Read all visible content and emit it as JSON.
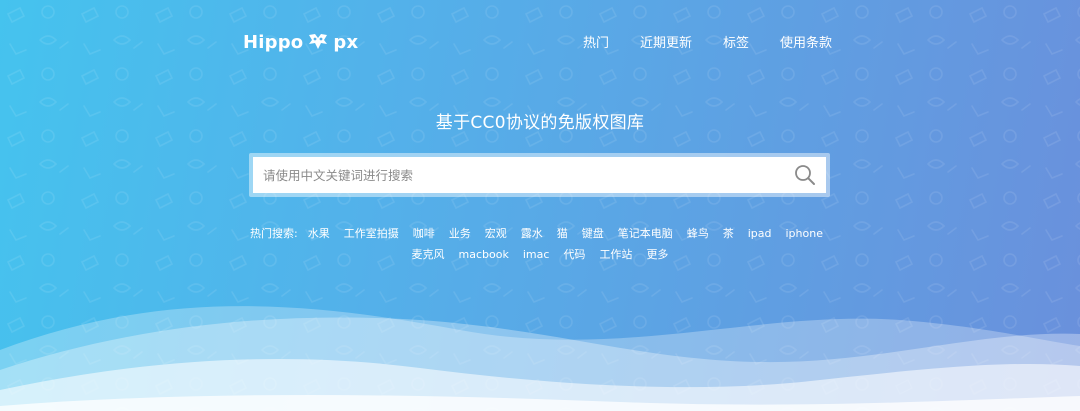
{
  "header": {
    "logo_left": "Hippo",
    "logo_right": "px",
    "nav": [
      {
        "label": "热门"
      },
      {
        "label": "近期更新"
      },
      {
        "label": "标签"
      },
      {
        "label": "使用条款"
      }
    ]
  },
  "hero": {
    "slogan": "基于CC0协议的免版权图库"
  },
  "search": {
    "placeholder": "请使用中文关键词进行搜索",
    "value": ""
  },
  "hot_searches": {
    "label": "热门搜索:",
    "items": [
      "水果",
      "工作室拍摄",
      "咖啡",
      "业务",
      "宏观",
      "露水",
      "猫",
      "键盘",
      "笔记本电脑",
      "蜂鸟",
      "茶",
      "ipad",
      "iphone",
      "麦克风",
      "macbook",
      "imac",
      "代码",
      "工作站",
      "更多"
    ]
  },
  "colors": {
    "gradient_start": "#45c3ee",
    "gradient_end": "#6a90dc",
    "search_border": "#d6e6f7"
  },
  "icons": {
    "logo_mark": "hippo-icon",
    "search": "search-icon"
  }
}
